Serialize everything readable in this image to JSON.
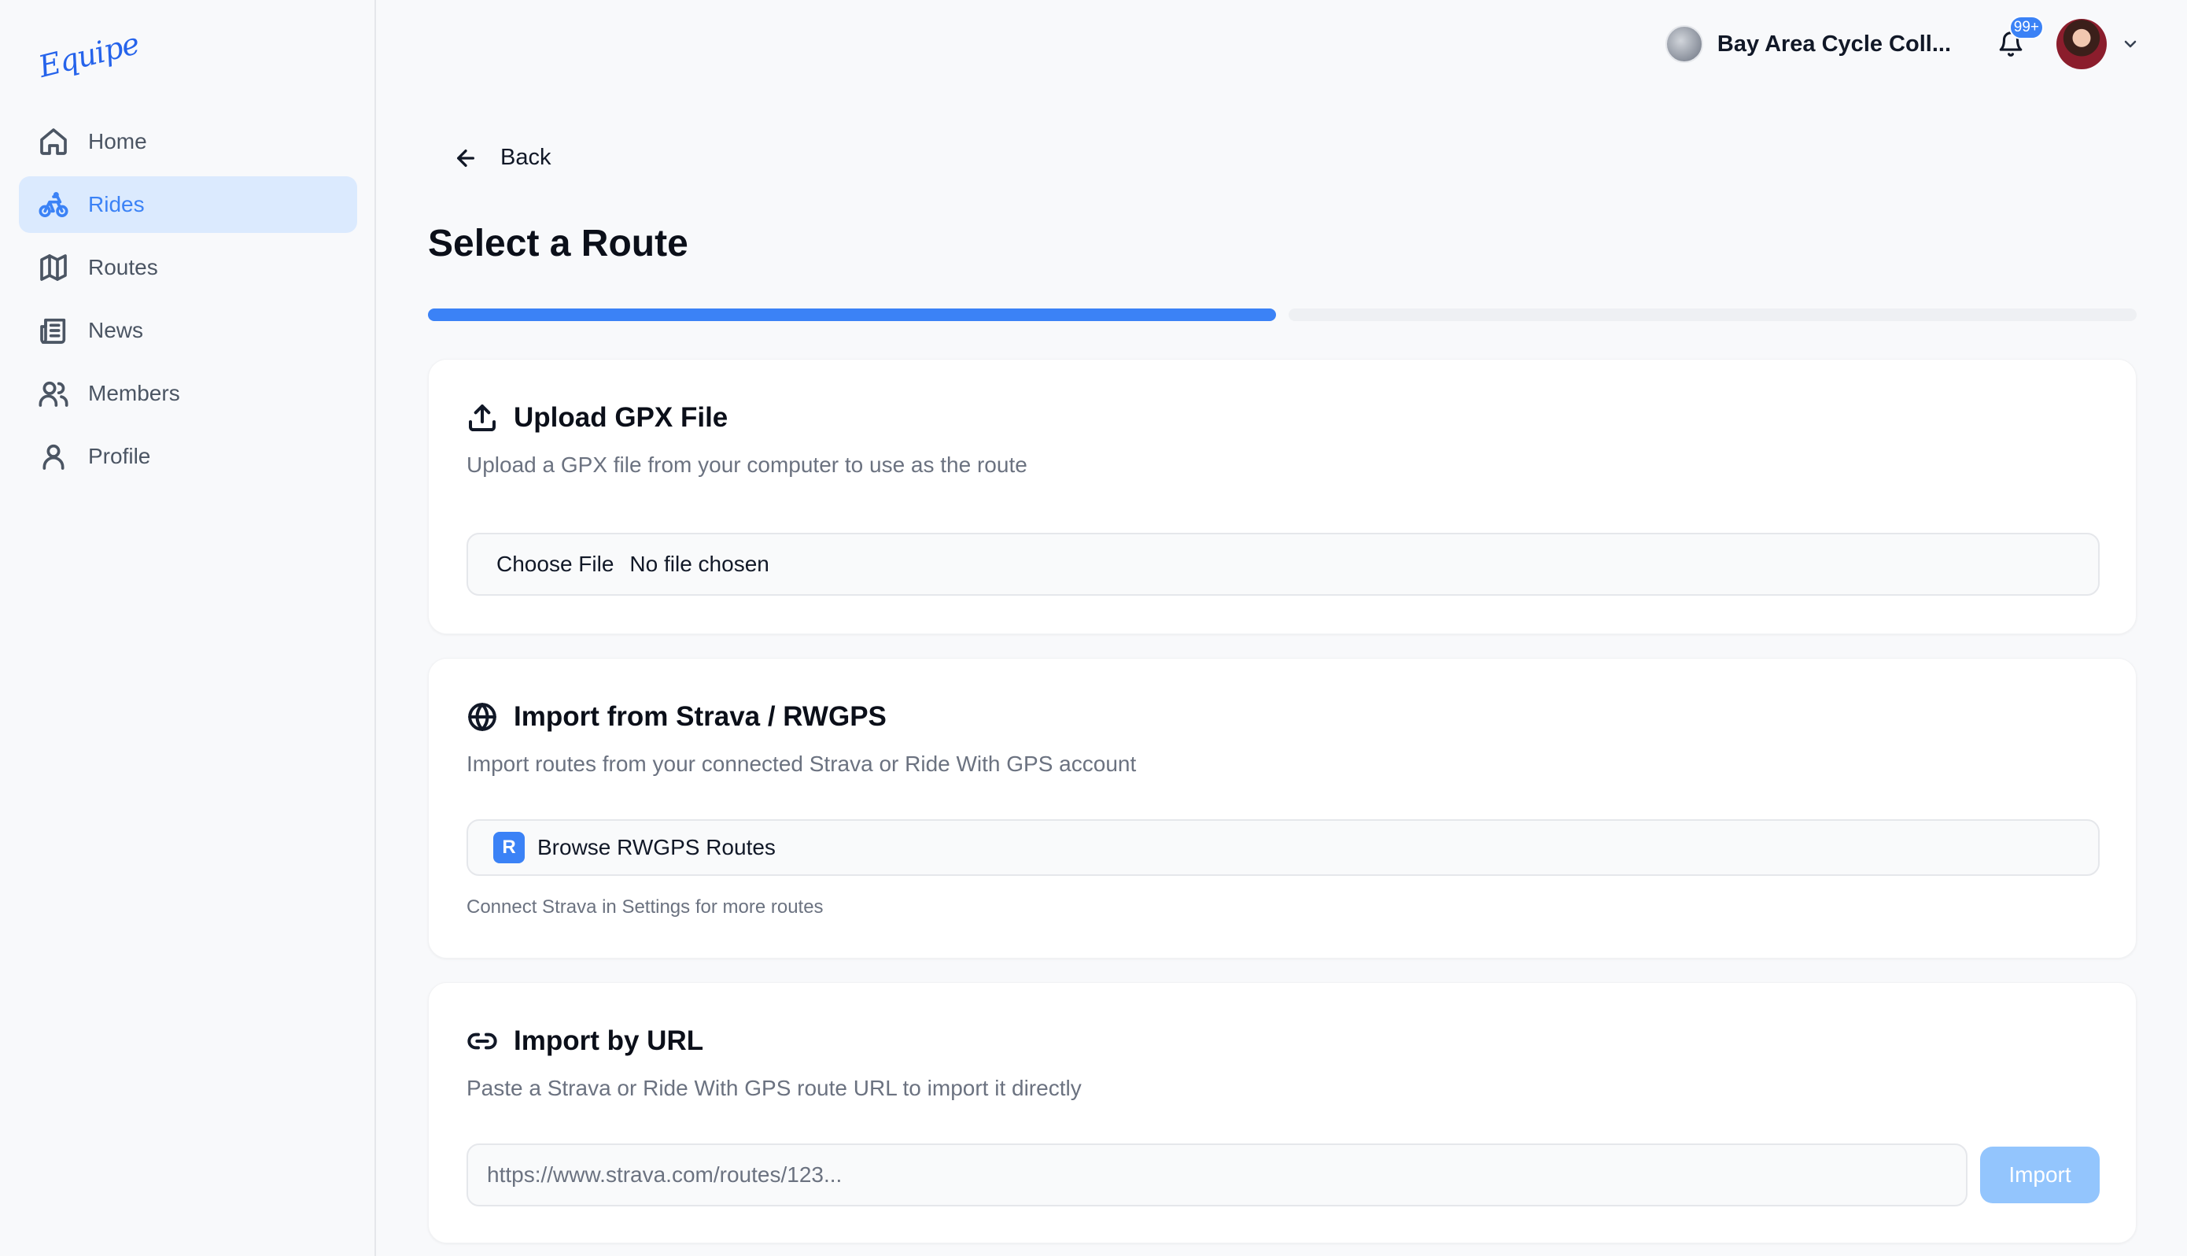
{
  "app": {
    "logo_text": "Equipe"
  },
  "sidebar": {
    "items": [
      {
        "label": "Home",
        "icon": "home-icon",
        "active": false
      },
      {
        "label": "Rides",
        "icon": "bike-icon",
        "active": true
      },
      {
        "label": "Routes",
        "icon": "map-icon",
        "active": false
      },
      {
        "label": "News",
        "icon": "newspaper-icon",
        "active": false
      },
      {
        "label": "Members",
        "icon": "users-icon",
        "active": false
      },
      {
        "label": "Profile",
        "icon": "user-icon",
        "active": false
      }
    ]
  },
  "header": {
    "club_name": "Bay Area Cycle Coll...",
    "notification_count": "99+"
  },
  "page": {
    "back_label": "Back",
    "title": "Select a Route",
    "progress_percent": 50
  },
  "upload_card": {
    "title": "Upload GPX File",
    "description": "Upload a GPX file from your computer to use as the route",
    "choose_file_label": "Choose File",
    "file_state": "No file chosen"
  },
  "strava_card": {
    "title": "Import from Strava / RWGPS",
    "description": "Import routes from your connected Strava or Ride With GPS account",
    "rwgps_logo": "R",
    "browse_label": "Browse RWGPS Routes",
    "hint": "Connect Strava in Settings for more routes"
  },
  "url_card": {
    "title": "Import by URL",
    "description": "Paste a Strava or Ride With GPS route URL to import it directly",
    "url_placeholder": "https://www.strava.com/routes/123...",
    "import_label": "Import"
  },
  "colors": {
    "accent": "#3b82f6",
    "active_nav_bg": "#dbeafe",
    "disabled_button": "#93c5fd"
  }
}
